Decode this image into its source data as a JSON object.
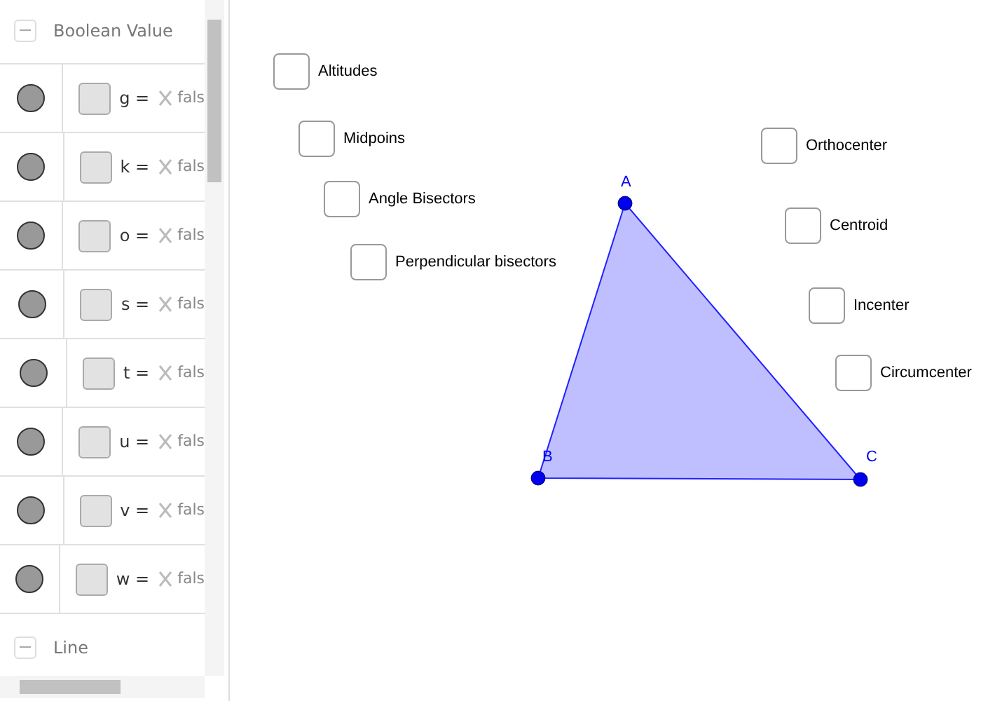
{
  "algebra_view": {
    "groups": [
      {
        "label": "Boolean Value",
        "expanded": true
      },
      {
        "label": "Line",
        "expanded": true
      }
    ],
    "rows": [
      {
        "text": "g =",
        "value": "fals",
        "shown": true,
        "checked": false
      },
      {
        "text": "k =",
        "value": "fals",
        "shown": true,
        "checked": false
      },
      {
        "text": "o =",
        "value": "fals",
        "shown": true,
        "checked": false
      },
      {
        "text": "s =",
        "value": "fals",
        "shown": true,
        "checked": false
      },
      {
        "text": "t =",
        "value": "fals",
        "shown": true,
        "checked": false
      },
      {
        "text": "u =",
        "value": "fals",
        "shown": true,
        "checked": false
      },
      {
        "text": "v =",
        "value": "fals",
        "shown": true,
        "checked": false
      },
      {
        "text": "w =",
        "value": "fals",
        "shown": true,
        "checked": false
      }
    ]
  },
  "graphics_view": {
    "checkboxes": [
      {
        "label": "Altitudes",
        "checked": false
      },
      {
        "label": "Midpoins",
        "checked": false
      },
      {
        "label": "Angle Bisectors",
        "checked": false
      },
      {
        "label": "Perpendicular bisectors",
        "checked": false
      },
      {
        "label": "Orthocenter",
        "checked": false
      },
      {
        "label": "Centroid",
        "checked": false
      },
      {
        "label": "Incenter",
        "checked": false
      },
      {
        "label": "Circumcenter",
        "checked": false
      }
    ],
    "points": [
      {
        "label": "A"
      },
      {
        "label": "B"
      },
      {
        "label": "C"
      }
    ]
  }
}
